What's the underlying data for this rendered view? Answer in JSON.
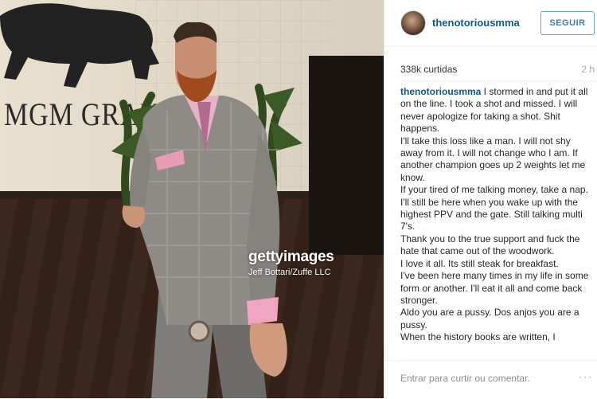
{
  "photo": {
    "wall_sign": "MGM GRAND",
    "watermark_logo": "gettyimages",
    "watermark_credit": "Jeff Bottari/Zuffe LLC"
  },
  "post": {
    "username": "thenotoriousmma",
    "follow_label": "SEGUIR",
    "likes": "338k curtidas",
    "time": "2 h",
    "caption_user": "thenotoriousmma",
    "caption_first": " I stormed in and put it all on the line. I took a shot and missed. I will never apologize for taking a shot. Shit happens.",
    "caption_lines": [
      "I'll take this loss like a man. I will not shy away from it. I will not change who I am. If another champion goes up 2 weights let me know.",
      "If your tired of me talking money, take a nap.",
      "I'll still be here when you wake up with the highest PPV and the gate. Still talking multi 7's.",
      "Thank you to the true support and fuck the hate that came out of the woodwork.",
      "I love it all. Its still steak for breakfast.",
      "I've been here many times in my life in some form or another. I'll eat it all and come back stronger.",
      "Aldo you are a pussy. Dos anjos you are a pussy.",
      "When the history books are written, I"
    ],
    "comment_placeholder": "Entrar para curtir ou comentar.",
    "more_label": "···"
  },
  "colors": {
    "username": "#125688",
    "follow_border": "#70a0c8",
    "follow_text": "#3a7cb8"
  }
}
